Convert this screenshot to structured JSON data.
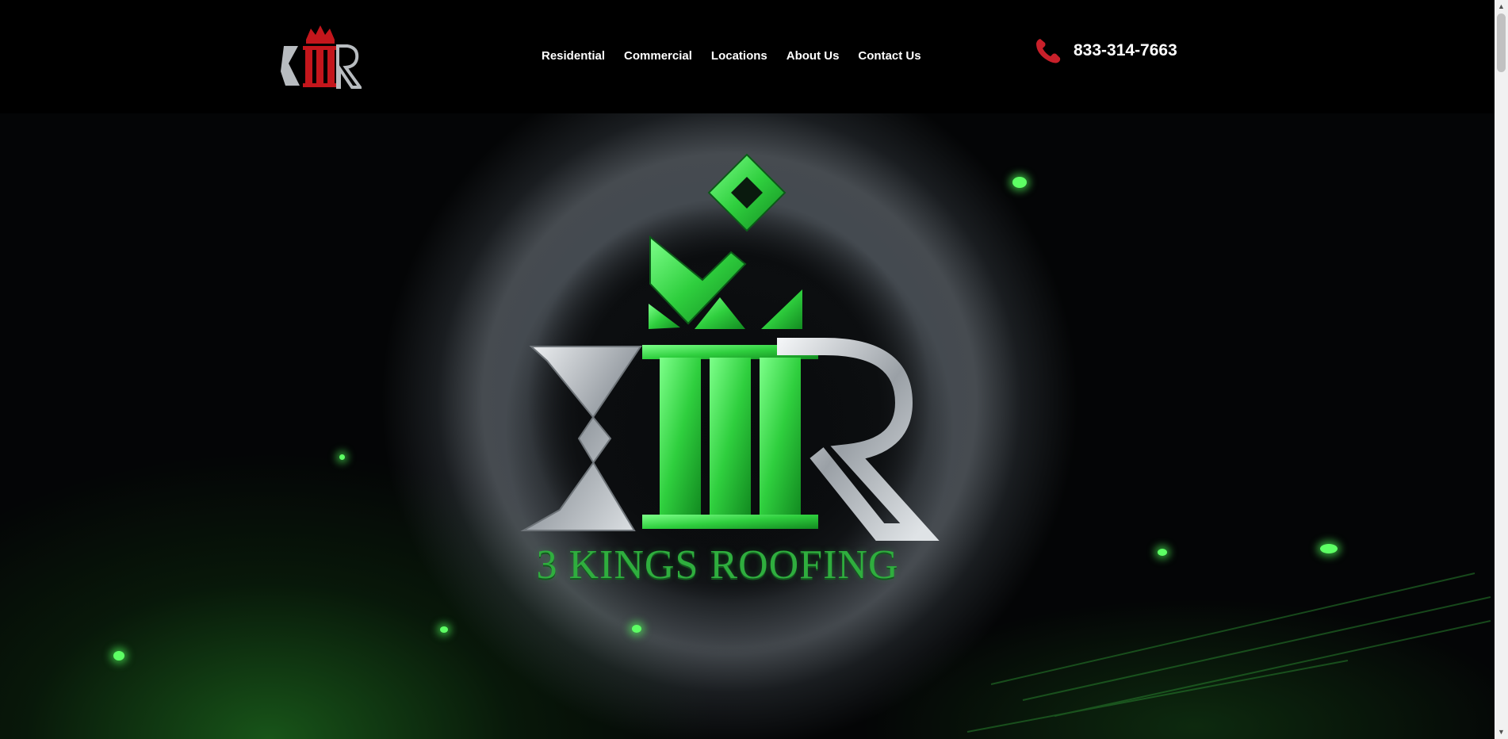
{
  "header": {
    "logo_alt": "3 Kings Roofing",
    "nav": [
      {
        "label": "Residential"
      },
      {
        "label": "Commercial"
      },
      {
        "label": "Locations"
      },
      {
        "label": "About Us"
      },
      {
        "label": "Contact Us"
      }
    ],
    "phone": {
      "number": "833-314-7663",
      "icon": "phone-icon"
    }
  },
  "hero": {
    "brand_name": "3 KINGS ROOFING",
    "emblem_icon": "kr-crown-emblem"
  },
  "colors": {
    "background": "#000000",
    "logo_red": "#c4161c",
    "brand_green": "#2fae3e",
    "silver": "#b8bcc0",
    "phone_icon": "#c8202a"
  }
}
